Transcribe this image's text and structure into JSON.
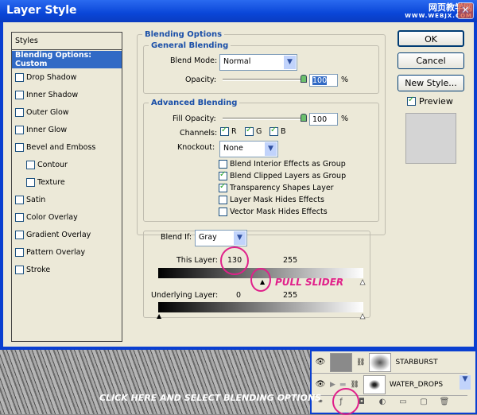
{
  "window": {
    "title": "Layer Style",
    "watermark": "网页教学网",
    "watermark_url": "WWW.WEBJX.COM"
  },
  "styles_list": {
    "header": "Styles",
    "items": [
      {
        "label": "Blending Options: Custom",
        "selected": true
      },
      {
        "label": "Drop Shadow",
        "checked": false
      },
      {
        "label": "Inner Shadow",
        "checked": false
      },
      {
        "label": "Outer Glow",
        "checked": false
      },
      {
        "label": "Inner Glow",
        "checked": false
      },
      {
        "label": "Bevel and Emboss",
        "checked": false
      },
      {
        "label": "Contour",
        "checked": false
      },
      {
        "label": "Texture",
        "checked": false
      },
      {
        "label": "Satin",
        "checked": false
      },
      {
        "label": "Color Overlay",
        "checked": false
      },
      {
        "label": "Gradient Overlay",
        "checked": false
      },
      {
        "label": "Pattern Overlay",
        "checked": false
      },
      {
        "label": "Stroke",
        "checked": false
      }
    ]
  },
  "blending": {
    "title": "Blending Options",
    "general_title": "General Blending",
    "blend_mode_label": "Blend Mode:",
    "blend_mode": "Normal",
    "opacity_label": "Opacity:",
    "opacity": "100",
    "percent": "%",
    "advanced_title": "Advanced Blending",
    "fill_opacity_label": "Fill Opacity:",
    "fill_opacity": "100",
    "channels_label": "Channels:",
    "channels": [
      "R",
      "G",
      "B"
    ],
    "knockout_label": "Knockout:",
    "knockout": "None",
    "options": [
      {
        "label": "Blend Interior Effects as Group",
        "checked": false
      },
      {
        "label": "Blend Clipped Layers as Group",
        "checked": true
      },
      {
        "label": "Transparency Shapes Layer",
        "checked": true
      },
      {
        "label": "Layer Mask Hides Effects",
        "checked": false
      },
      {
        "label": "Vector Mask Hides Effects",
        "checked": false
      }
    ],
    "blend_if_label": "Blend If:",
    "blend_if": "Gray",
    "this_layer_label": "This Layer:",
    "this_layer_low": "130",
    "this_layer_high": "255",
    "underlying_label": "Underlying Layer:",
    "underlying_low": "0",
    "underlying_high": "255"
  },
  "buttons": {
    "ok": "OK",
    "cancel": "Cancel",
    "new_style": "New Style...",
    "preview": "Preview"
  },
  "annotations": {
    "pull": "PULL SLIDER",
    "click": "CLICK HERE AND SELECT BLENDING OPTIONS"
  },
  "layers": [
    {
      "name": "STARBURST"
    },
    {
      "name": "WATER_DROPS"
    }
  ],
  "colors": {
    "accent": "#316ac5",
    "annotation": "#e0208a",
    "legend": "#1a4fa8"
  }
}
